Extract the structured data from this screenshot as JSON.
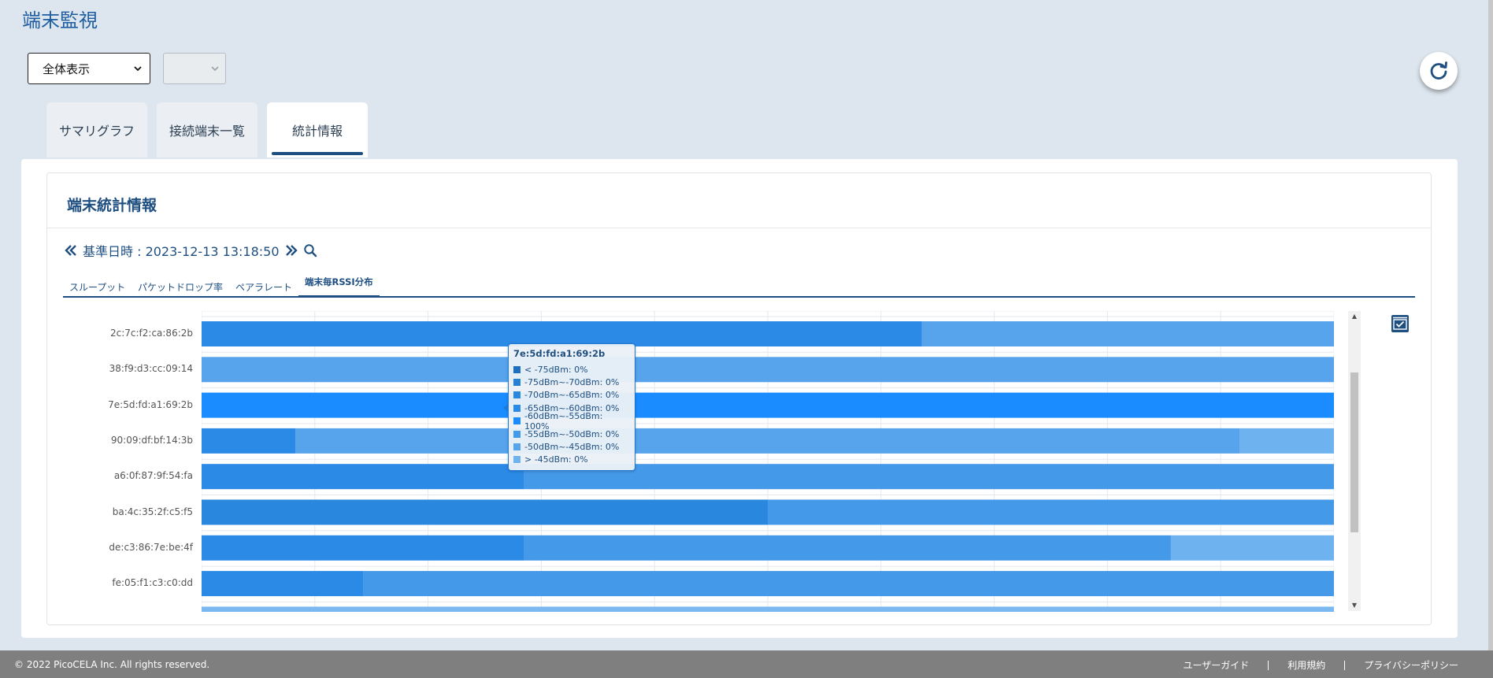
{
  "page": {
    "title": "端末監視"
  },
  "filters": {
    "main_select_value": "全体表示",
    "sub_select_value": ""
  },
  "tabs": [
    {
      "label": "サマリグラフ",
      "active": false
    },
    {
      "label": "接続端末一覧",
      "active": false
    },
    {
      "label": "統計情報",
      "active": true
    }
  ],
  "card": {
    "title": "端末統計情報"
  },
  "date_nav": {
    "label": "基準日時 : 2023-12-13 13:18:50"
  },
  "subtabs": [
    {
      "label": "スループット",
      "active": false
    },
    {
      "label": "パケットドロップ率",
      "active": false
    },
    {
      "label": "ペアラレート",
      "active": false
    },
    {
      "label": "端末毎RSSI分布",
      "active": true
    }
  ],
  "colors": {
    "accent": "#1e4f80",
    "bins": [
      "#1f6fc0",
      "#2680d4",
      "#2a87de",
      "#2b8ae6",
      "#1a8cff",
      "#4499e8",
      "#58a4ec",
      "#6eb2f0"
    ]
  },
  "chart_data": {
    "type": "bar",
    "orientation": "horizontal",
    "stacked": true,
    "percent_stacked": true,
    "xlim": [
      0,
      100
    ],
    "grid": true,
    "categories": [
      "2c:7c:f2:ca:86:2b",
      "38:f9:d3:cc:09:14",
      "7e:5d:fd:a1:69:2b",
      "90:09:df:bf:14:3b",
      "a6:0f:87:9f:54:fa",
      "ba:4c:35:2f:c5:f5",
      "de:c3:86:7e:be:4f",
      "fe:05:f1:c3:c0:dd"
    ],
    "series": [
      {
        "name": "< -75dBm",
        "values": [
          0,
          0,
          0,
          0,
          0,
          0,
          0,
          0
        ]
      },
      {
        "name": "-75dBm~-70dBm",
        "values": [
          0,
          0,
          0,
          0,
          0,
          0,
          0,
          0
        ]
      },
      {
        "name": "-70dBm~-65dBm",
        "values": [
          0,
          0,
          0,
          0,
          0,
          50,
          0,
          0
        ]
      },
      {
        "name": "-65dBm~-60dBm",
        "values": [
          63.6,
          0,
          0,
          8.3,
          28.5,
          0,
          28.5,
          14.3
        ]
      },
      {
        "name": "-60dBm~-55dBm",
        "values": [
          0,
          0,
          100,
          0,
          0,
          0,
          0,
          0
        ]
      },
      {
        "name": "-55dBm~-50dBm",
        "values": [
          0,
          0,
          0,
          0,
          71.5,
          50,
          57.1,
          85.7
        ]
      },
      {
        "name": "-50dBm~-45dBm",
        "values": [
          36.4,
          100,
          0,
          83.4,
          0,
          0,
          0,
          0
        ]
      },
      {
        "name": "> -45dBm",
        "values": [
          0,
          0,
          0,
          8.3,
          0,
          0,
          14.4,
          0
        ]
      }
    ]
  },
  "tooltip": {
    "title": "7e:5d:fd:a1:69:2b",
    "rows": [
      {
        "label": "< -75dBm: 0%"
      },
      {
        "label": "-75dBm~-70dBm: 0%"
      },
      {
        "label": "-70dBm~-65dBm: 0%"
      },
      {
        "label": "-65dBm~-60dBm: 0%"
      },
      {
        "label": "-60dBm~-55dBm: 100%"
      },
      {
        "label": "-55dBm~-50dBm: 0%"
      },
      {
        "label": "-50dBm~-45dBm: 0%"
      },
      {
        "label": "> -45dBm: 0%"
      }
    ]
  },
  "footer": {
    "copyright": "© 2022 PicoCELA Inc. All rights reserved.",
    "links": [
      "ユーザーガイド",
      "利用規約",
      "プライバシーポリシー"
    ]
  },
  "icons": {
    "refresh": "refresh-icon",
    "prev": "double-chevron-left-icon",
    "next": "double-chevron-right-icon",
    "search": "search-icon",
    "download": "check-box-icon"
  }
}
